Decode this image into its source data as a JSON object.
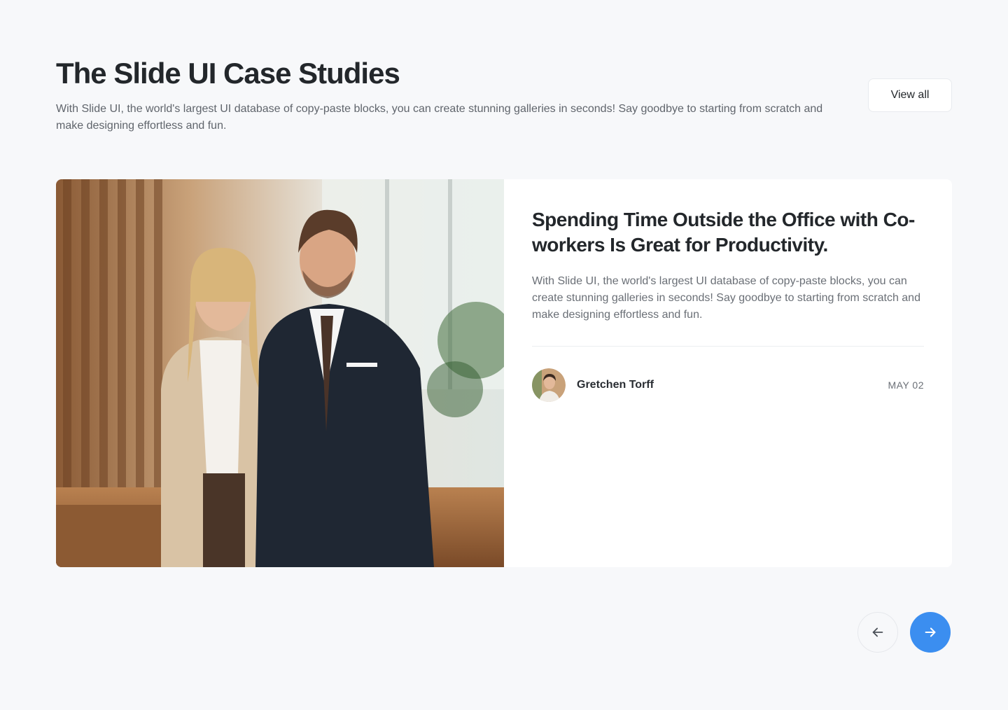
{
  "header": {
    "title": "The Slide UI Case Studies",
    "subtitle": "With Slide UI, the world's largest UI database of copy-paste blocks, you can create stunning galleries in seconds! Say goodbye to starting from scratch and make designing effortless and fun.",
    "view_all_label": "View all"
  },
  "card": {
    "title": "Spending Time Outside the Office with Co-workers Is Great for Productivity.",
    "excerpt": "With Slide UI, the world's largest UI database of copy-paste blocks, you can create stunning galleries in seconds! Say goodbye to starting from scratch and make designing effortless and fun.",
    "author": "Gretchen Torff",
    "date": "MAY 02"
  },
  "icons": {
    "prev": "arrow-left-icon",
    "next": "arrow-right-icon"
  },
  "colors": {
    "accent": "#3b8ef0",
    "background": "#f7f8fa",
    "title": "#23272b",
    "body": "#60656c"
  }
}
